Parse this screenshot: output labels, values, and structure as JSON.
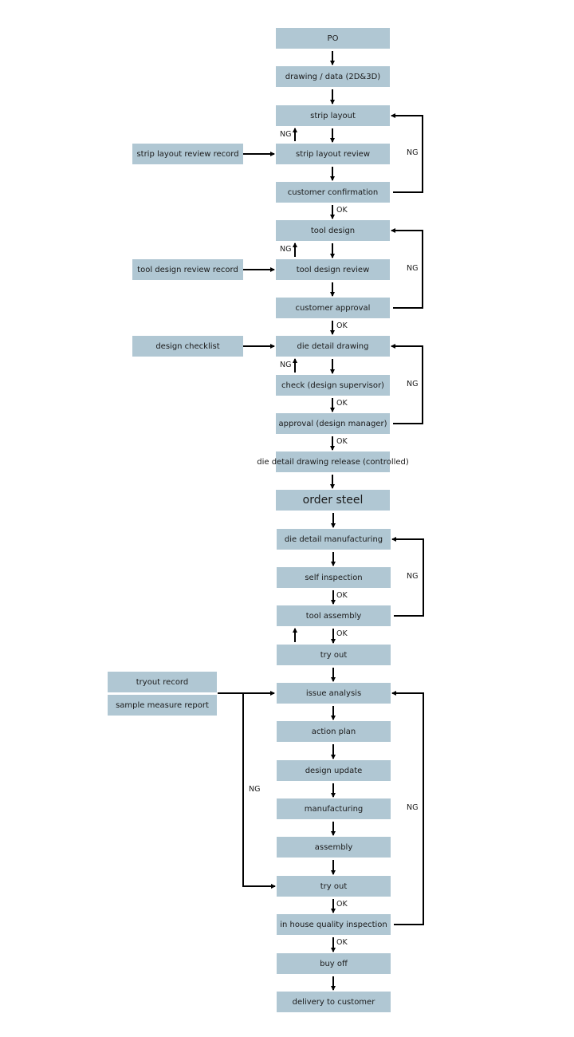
{
  "main_steps": [
    "PO",
    "drawing  / data (2D&3D)",
    "strip layout",
    "strip layout review",
    "customer confirmation",
    "tool design",
    "tool design review",
    "customer approval",
    "die detail drawing",
    "check (design supervisor)",
    "approval (design manager)",
    "die detail drawing release (controlled)",
    "order steel",
    "die detail manufacturing",
    "self inspection",
    "tool assembly",
    "try out",
    "issue analysis",
    "action plan",
    "design update",
    "manufacturing",
    "assembly",
    "try out",
    "in house quality inspection",
    "buy off",
    "delivery to customer"
  ],
  "inputs": [
    "strip layout review record",
    "tool design review record",
    "design checklist",
    "tryout  record",
    "sample measure report"
  ],
  "edge_labels": {
    "ok": "OK",
    "ng": "NG"
  },
  "box_color": "#b0c7d3"
}
